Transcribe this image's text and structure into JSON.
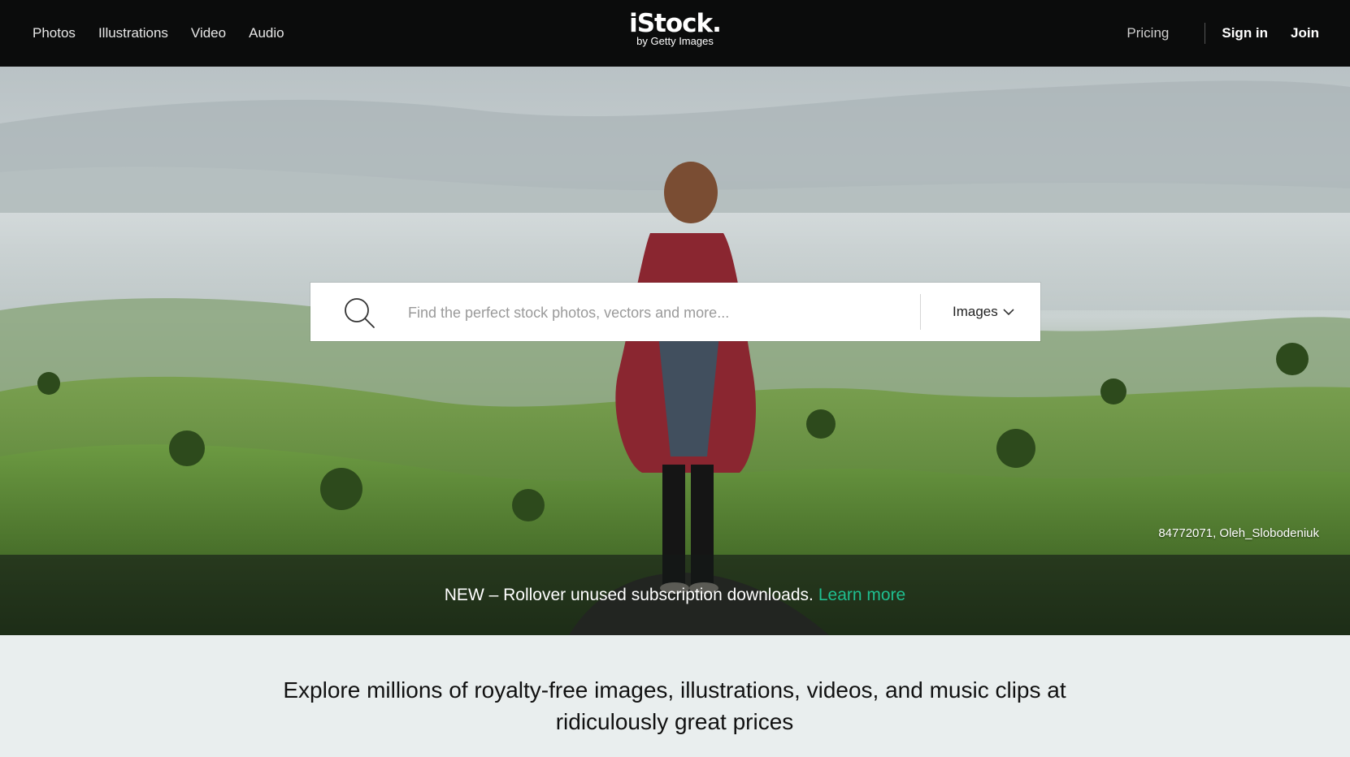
{
  "nav": {
    "links": [
      "Photos",
      "Illustrations",
      "Video",
      "Audio"
    ],
    "logo_main": "iStock.",
    "logo_sub": "by Getty Images",
    "pricing": "Pricing",
    "sign_in": "Sign in",
    "join": "Join"
  },
  "search": {
    "placeholder": "Find the perfect stock photos, vectors and more...",
    "value": "",
    "type_selected": "Images",
    "icon": "search-icon"
  },
  "hero": {
    "credit": "84772071, Oleh_Slobodeniuk",
    "banner_text": "NEW – Rollover unused subscription downloads.",
    "banner_link": "Learn more"
  },
  "explore": {
    "text": "Explore millions of royalty-free images, illustrations, videos, and music clips at ridiculously great prices"
  },
  "colors": {
    "nav_bg": "#0b0c0c",
    "accent_link": "#1fbf90",
    "page_bg": "#e9eeee"
  }
}
